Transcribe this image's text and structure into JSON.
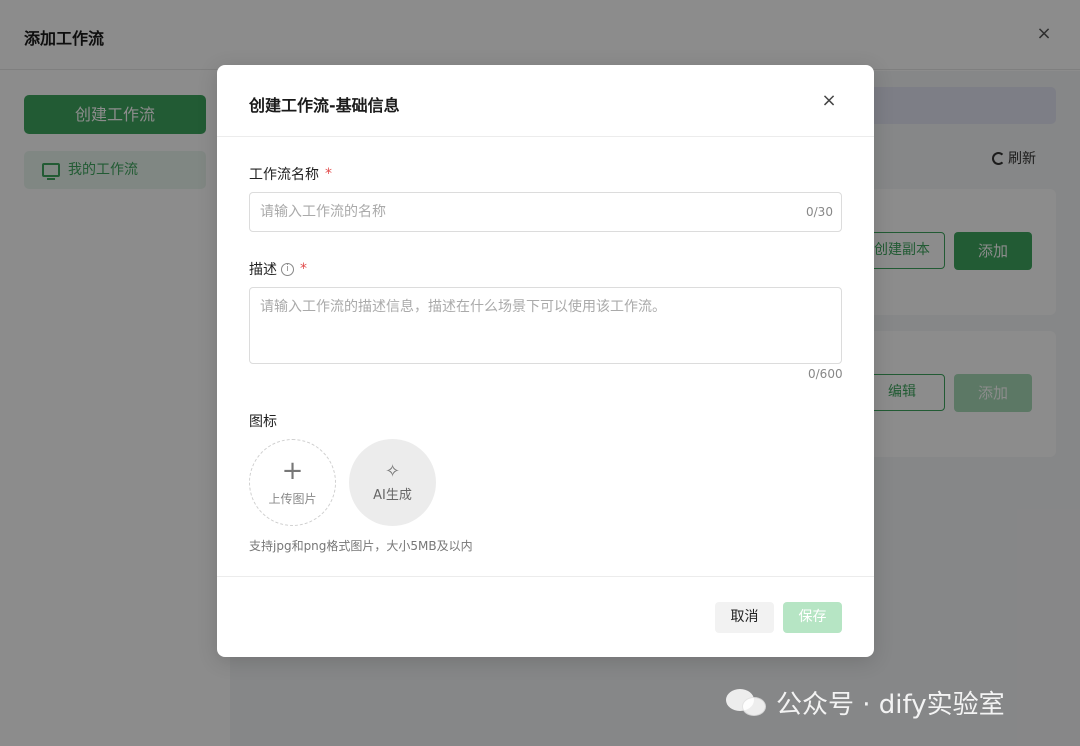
{
  "background": {
    "title": "添加工作流",
    "close_label": "×",
    "sidebar": {
      "create_button": "创建工作流",
      "nav_item": "我的工作流"
    },
    "refresh_label": "刷新",
    "cards": [
      {
        "secondary_button": "创建副本",
        "primary_button": "添加"
      },
      {
        "secondary_button": "编辑",
        "primary_button": "添加"
      }
    ]
  },
  "modal": {
    "title": "创建工作流-基础信息",
    "close_label": "×",
    "name_field": {
      "label": "工作流名称",
      "required_mark": "*",
      "placeholder": "请输入工作流的名称",
      "value": "",
      "count": "0/30"
    },
    "description_field": {
      "label": "描述",
      "info_mark": "i",
      "required_mark": "*",
      "placeholder": "请输入工作流的描述信息，描述在什么场景下可以使用该工作流。",
      "value": "",
      "count": "0/600"
    },
    "icon_field": {
      "label": "图标",
      "upload_label": "上传图片",
      "ai_label": "AI生成",
      "hint": "支持jpg和png格式图片，大小5MB及以内"
    },
    "footer": {
      "cancel_label": "取消",
      "save_label": "保存"
    }
  },
  "watermark": {
    "text": "公众号 · dify实验室"
  },
  "colors": {
    "accent": "#3fa75f",
    "accent_disabled": "#b6e5c4",
    "required": "#e14a4a"
  }
}
